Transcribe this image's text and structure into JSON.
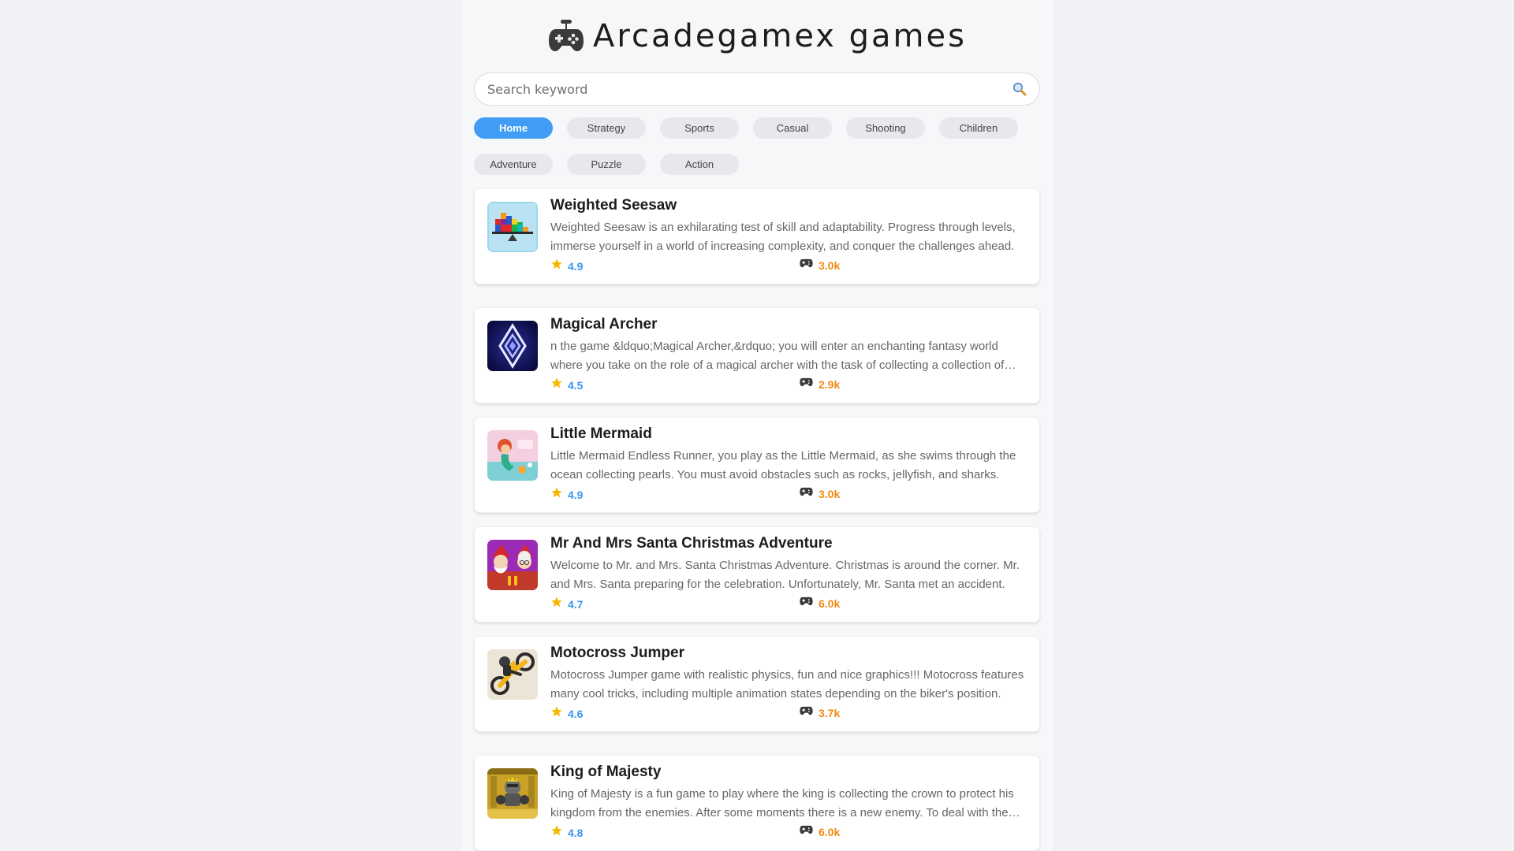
{
  "site": {
    "title": "Arcadegamex games",
    "logo_icon": "gamepad-icon"
  },
  "search": {
    "placeholder": "Search keyword",
    "value": "",
    "icon": "search-icon"
  },
  "tabs": [
    {
      "label": "Home",
      "active": true
    },
    {
      "label": "Strategy"
    },
    {
      "label": "Sports"
    },
    {
      "label": "Casual"
    },
    {
      "label": "Shooting"
    },
    {
      "label": "Children"
    },
    {
      "label": "Adventure"
    },
    {
      "label": "Puzzle"
    },
    {
      "label": "Action"
    }
  ],
  "colors": {
    "accent": "#409cf4",
    "rating": "#3b95ee",
    "plays": "#f08a14",
    "star": "#f5b800"
  },
  "games": [
    {
      "title": "Weighted Seesaw",
      "description": "Weighted Seesaw is an exhilarating test of skill and adaptability. Progress through levels, immerse yourself in a world of increasing complexity, and conquer the challenges ahead.",
      "rating": "4.9",
      "plays": "3.0k",
      "thumb_icon": "seesaw-blocks-thumbnail"
    },
    {
      "title": "Magical Archer",
      "description": "n the game &ldquo;Magical Archer,&rdquo; you will enter an enchanting fantasy world where you take on the role of a magical archer with the task of collecting a collection of magical gems.",
      "rating": "4.5",
      "plays": "2.9k",
      "thumb_icon": "diamond-crystal-thumbnail"
    },
    {
      "title": "Little Mermaid",
      "description": "Little Mermaid Endless Runner, you play as the Little Mermaid, as she swims through the ocean collecting pearls. You must avoid obstacles such as rocks, jellyfish, and sharks.",
      "rating": "4.9",
      "plays": "3.0k",
      "thumb_icon": "mermaid-thumbnail"
    },
    {
      "title": "Mr And Mrs Santa Christmas Adventure",
      "description": "Welcome to Mr. and Mrs. Santa Christmas Adventure. Christmas is around the corner. Mr. and Mrs. Santa preparing for the celebration. Unfortunately, Mr. Santa met an accident.",
      "rating": "4.7",
      "plays": "6.0k",
      "thumb_icon": "santa-couple-thumbnail"
    },
    {
      "title": "Motocross Jumper",
      "description": "Motocross Jumper game with realistic physics, fun and nice graphics!!! Motocross features many cool tricks, including multiple animation states depending on the biker's position.",
      "rating": "4.6",
      "plays": "3.7k",
      "thumb_icon": "motocross-rider-thumbnail"
    },
    {
      "title": "King of Majesty",
      "description": "King of Majesty is a fun game to play where the king is collecting the crown to protect his kingdom from the enemies. After some moments there is a new enemy. To deal with them you must be careful.",
      "rating": "4.8",
      "plays": "6.0k",
      "thumb_icon": "king-knight-thumbnail"
    }
  ]
}
